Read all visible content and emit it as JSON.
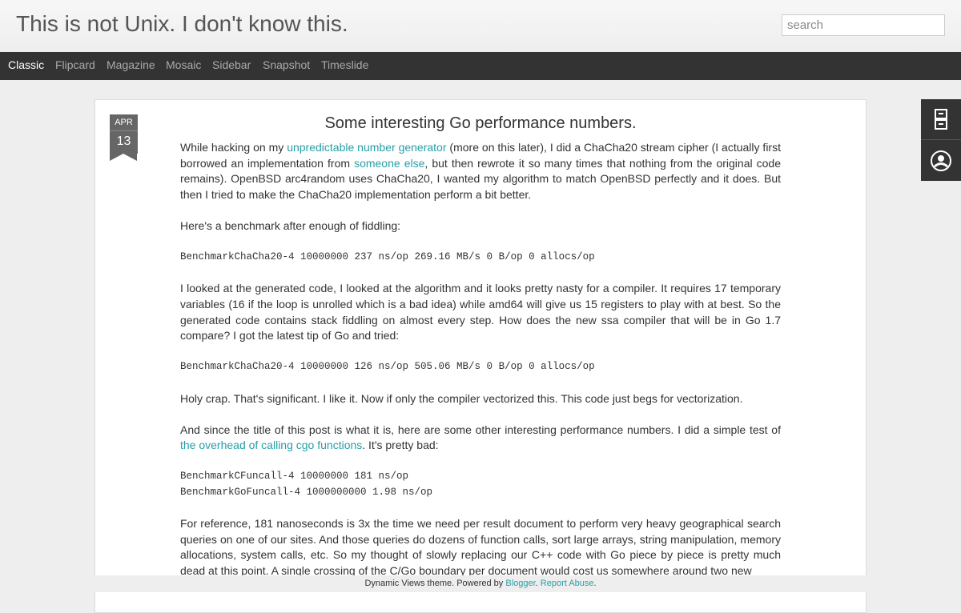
{
  "header": {
    "blog_title": "This is not Unix. I don't know this.",
    "search_placeholder": "search"
  },
  "nav": {
    "items": [
      "Classic",
      "Flipcard",
      "Magazine",
      "Mosaic",
      "Sidebar",
      "Snapshot",
      "Timeslide"
    ],
    "active": "Classic"
  },
  "post": {
    "date_month": "APR",
    "date_day": "13",
    "title": "Some interesting Go performance numbers.",
    "p1_pre": "While hacking on my ",
    "p1_link1": "unpredictable number generator",
    "p1_mid1": " (more on this later), I did a ChaCha20 stream cipher (I actually first borrowed an implementation from ",
    "p1_link2": "someone else",
    "p1_post": ", but then rewrote it so many times that nothing from the original code remains). OpenBSD arc4random uses ChaCha20, I wanted my algorithm to match OpenBSD perfectly and it does. But then I tried to make the ChaCha20 implementation perform a bit better.",
    "p2": "Here's a benchmark after enough of fiddling:",
    "code1": "BenchmarkChaCha20-4 10000000 237 ns/op 269.16 MB/s 0 B/op 0 allocs/op",
    "p3": "I looked at the generated code, I looked at the algorithm and it looks pretty nasty for a compiler. It requires 17 temporary variables (16 if the loop is unrolled which is a bad idea) while amd64 will give us 15 registers to play with at best. So the generated code contains stack fiddling on almost every step. How does the new ssa compiler that will be in Go 1.7 compare? I got the latest tip of Go and tried:",
    "code2": "BenchmarkChaCha20-4 10000000 126 ns/op 505.06 MB/s 0 B/op 0 allocs/op",
    "p4": "Holy crap. That's significant. I like it. Now if only the compiler vectorized this. This code just begs for vectorization.",
    "p5_pre": "And since the title of this post is what it is, here are some other interesting performance numbers. I did a simple test of ",
    "p5_link": "the overhead of calling cgo functions",
    "p5_post": ". It's pretty bad:",
    "code3a": "BenchmarkCFuncall-4 10000000 181 ns/op",
    "code3b": "BenchmarkGoFuncall-4 1000000000 1.98 ns/op",
    "p6": "For reference, 181 nanoseconds is 3x the time we need per result document to perform very heavy geographical search queries on one of our sites. And those queries do dozens of function calls, sort large arrays, string manipulation, memory allocations, system calls, etc. So my thought of slowly replacing our C++ code with Go piece by piece is pretty much dead at this point. A single crossing of the C/Go boundary per document would cost us somewhere around two new"
  },
  "dock": {
    "icons": [
      "archive-icon",
      "profile-icon"
    ]
  },
  "footer": {
    "pre": "Dynamic Views theme. Powered by ",
    "link1": "Blogger",
    "mid": ". ",
    "link2": "Report Abuse",
    "post": "."
  },
  "colors": {
    "link": "#259fa8",
    "navbar": "#333333",
    "background": "#eeeeee"
  }
}
